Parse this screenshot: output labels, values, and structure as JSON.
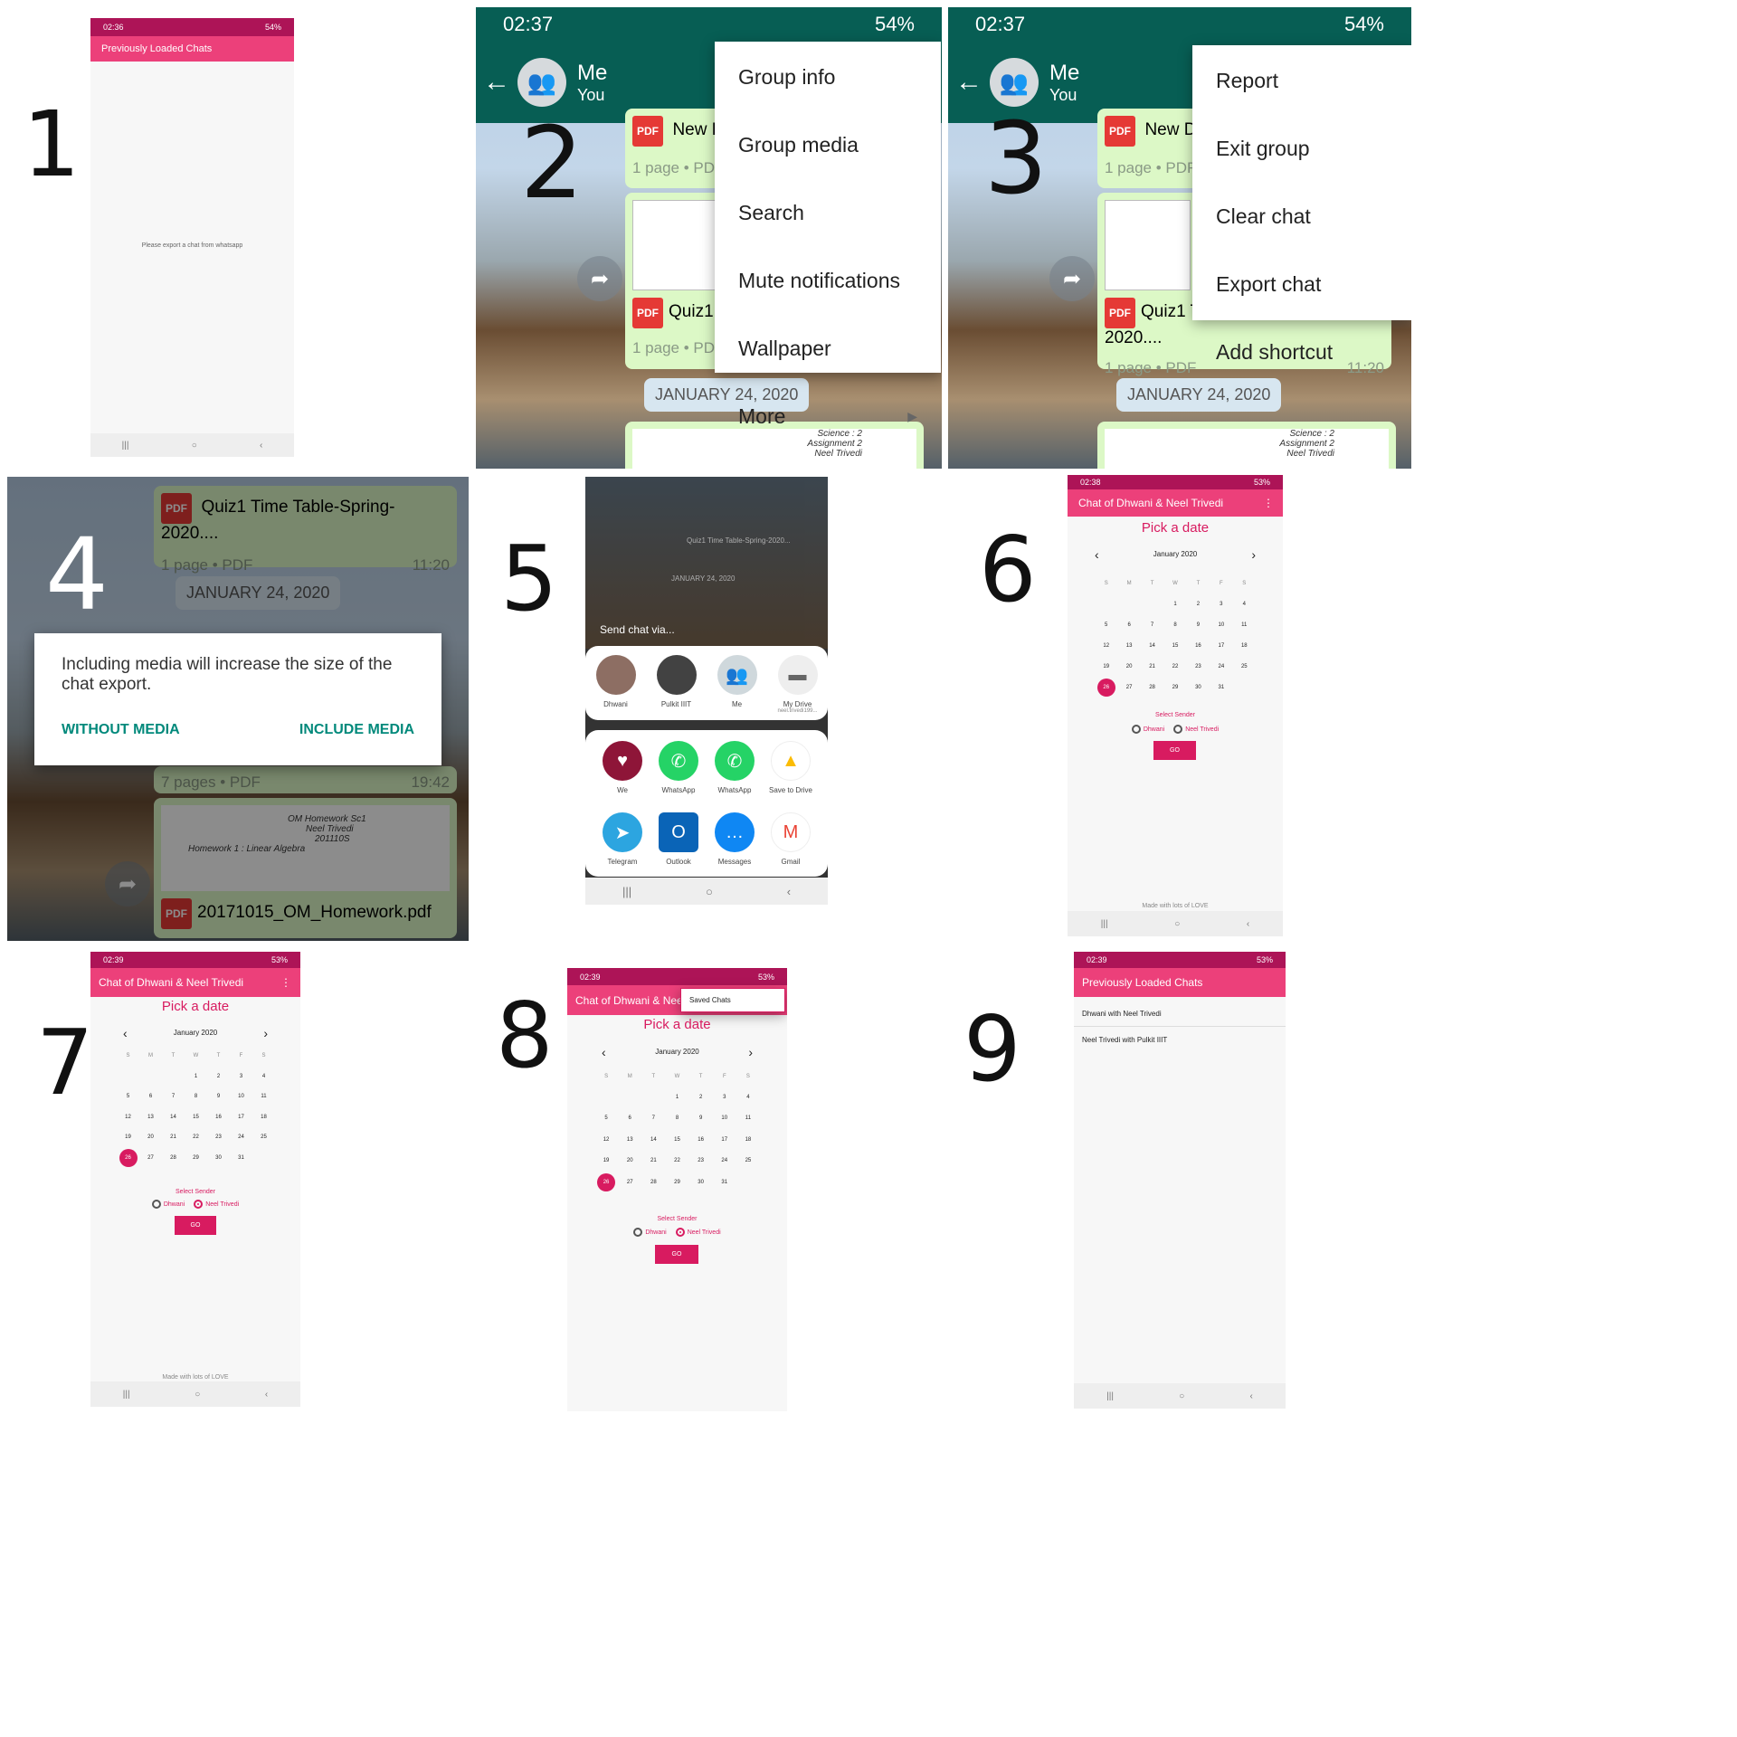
{
  "labels": [
    "1",
    "2",
    "3",
    "4",
    "5",
    "6",
    "7",
    "8",
    "9"
  ],
  "p1": {
    "status_time": "02:36",
    "status_right": "54%",
    "title": "Previously Loaded Chats",
    "empty": "Please export a chat from whatsapp",
    "color": "#ec407a"
  },
  "wa": {
    "time": "02:37",
    "battery": "54%",
    "name": "Me",
    "sub": "You",
    "pdf1": "New D",
    "pdf1_full": "New Do",
    "pages": "1 page • PDF",
    "pdf2": "Quiz1",
    "pdf2_full": "Quiz1 Time Table Spring 2020....",
    "time_sent": "11:20",
    "date_chip": "JANUARY 24, 2020",
    "note1": "Science : 2",
    "note2": "Assignment 2",
    "note3": "Neel Trivedi"
  },
  "menu2": [
    "Group info",
    "Group media",
    "Search",
    "Mute notifications",
    "Wallpaper",
    "More"
  ],
  "menu3": [
    "Report",
    "Exit group",
    "Clear chat",
    "Export chat",
    "Add shortcut"
  ],
  "p4": {
    "pdf": "Quiz1 Time Table-Spring-2020....",
    "pages": "1 page • PDF",
    "time": "11:20",
    "chip": "JANUARY 24, 2020",
    "dialog": "Including media will increase the size of the chat export.",
    "without": "WITHOUT MEDIA",
    "include": "INCLUDE MEDIA",
    "pages2": "7 pages • PDF",
    "time2": "19:42",
    "note_a": "OM Homework Sc1",
    "note_b": "Neel Trivedi",
    "note_c": "201110S",
    "note_d": "Homework 1 : Linear Algebra",
    "file": "20171015_OM_Homework.pdf"
  },
  "p5": {
    "header": "Send chat via...",
    "bg_pdf": "Quiz1 Time Table-Spring-2020...",
    "bg_chip": "JANUARY 24, 2020",
    "contacts": [
      {
        "name": "Dhwani",
        "sub": ""
      },
      {
        "name": "Pulkit IIIT",
        "sub": ""
      },
      {
        "name": "Me",
        "sub": ""
      },
      {
        "name": "My Drive",
        "sub": "neel.trivedi199..."
      }
    ],
    "apps": [
      {
        "name": "We",
        "color": "#8e1538",
        "glyph": "♥"
      },
      {
        "name": "WhatsApp",
        "color": "#25d366",
        "glyph": "✆"
      },
      {
        "name": "WhatsApp",
        "color": "#25d366",
        "glyph": "✆"
      },
      {
        "name": "Save to Drive",
        "color": "#fbbc04",
        "glyph": "▲"
      },
      {
        "name": "Telegram",
        "color": "#2ca5e0",
        "glyph": "➤"
      },
      {
        "name": "Outlook",
        "color": "#0a64b7",
        "glyph": "O"
      },
      {
        "name": "Messages",
        "color": "#0f87f3",
        "glyph": "…"
      },
      {
        "name": "Gmail",
        "color": "#ea4335",
        "glyph": "M"
      }
    ]
  },
  "cal": {
    "chat_title": "Chat of Dhwani & Neel Trivedi",
    "chat_title_short": "Chat of Dhwani & Nee",
    "pick": "Pick a date",
    "month": "January 2020",
    "weekdays": [
      "S",
      "M",
      "T",
      "W",
      "T",
      "F",
      "S"
    ],
    "days": [
      "",
      "",
      "",
      "1",
      "2",
      "3",
      "4",
      "5",
      "6",
      "7",
      "8",
      "9",
      "10",
      "11",
      "12",
      "13",
      "14",
      "15",
      "16",
      "17",
      "18",
      "19",
      "20",
      "21",
      "22",
      "23",
      "24",
      "25",
      "26",
      "27",
      "28",
      "29",
      "30",
      "31"
    ],
    "selected": "26",
    "select_sender": "Select Sender",
    "sender1": "Dhwani",
    "sender2": "Neel Trivedi",
    "go": "GO",
    "love": "Made with lots of LOVE",
    "saved": "Saved Chats",
    "menu_dots": "⋮",
    "prev": "‹",
    "next": "›"
  },
  "st6": {
    "time": "02:38",
    "right": "53%"
  },
  "st7": {
    "time": "02:39",
    "right": "53%"
  },
  "p9": {
    "time": "02:39",
    "right": "53%",
    "title": "Previously Loaded Chats",
    "items": [
      "Dhwani with Neel Trivedi",
      "Neel Trivedi with Pulkit IIIT"
    ]
  },
  "nav": {
    "recent": "|||",
    "home": "○",
    "back": "‹"
  },
  "colors": {
    "pink": "#ec407a",
    "pink_dark": "#ad1457",
    "accent": "#d81b60",
    "wa_green": "#075e54",
    "dialog_teal": "#00897b"
  }
}
